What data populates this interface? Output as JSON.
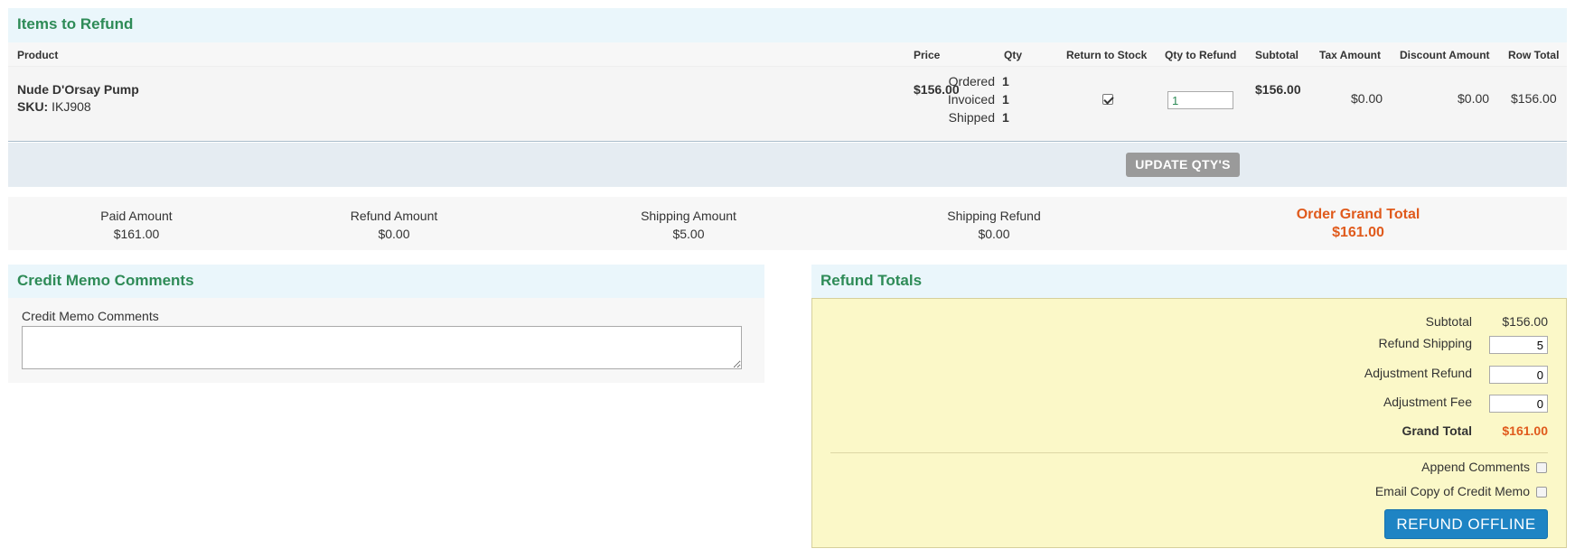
{
  "items_panel": {
    "title": "Items to Refund",
    "columns": {
      "product": "Product",
      "price": "Price",
      "qty": "Qty",
      "return_to_stock": "Return to Stock",
      "qty_to_refund": "Qty to Refund",
      "subtotal": "Subtotal",
      "tax_amount": "Tax Amount",
      "discount_amount": "Discount Amount",
      "row_total": "Row Total"
    },
    "row": {
      "product_name": "Nude D'Orsay Pump",
      "sku_label": "SKU:",
      "sku": "IKJ908",
      "price": "$156.00",
      "qty_ordered_label": "Ordered",
      "qty_ordered": "1",
      "qty_invoiced_label": "Invoiced",
      "qty_invoiced": "1",
      "qty_shipped_label": "Shipped",
      "qty_shipped": "1",
      "return_to_stock": true,
      "qty_to_refund": "1",
      "subtotal": "$156.00",
      "tax_amount": "$0.00",
      "discount_amount": "$0.00",
      "row_total": "$156.00"
    },
    "update_button": "UPDATE QTY'S"
  },
  "summary": {
    "paid_amount_label": "Paid Amount",
    "paid_amount": "$161.00",
    "refund_amount_label": "Refund Amount",
    "refund_amount": "$0.00",
    "shipping_amount_label": "Shipping Amount",
    "shipping_amount": "$5.00",
    "shipping_refund_label": "Shipping Refund",
    "shipping_refund": "$0.00",
    "grand_total_label": "Order Grand Total",
    "grand_total": "$161.00"
  },
  "comments_panel": {
    "title": "Credit Memo Comments",
    "field_label": "Credit Memo Comments",
    "field_value": ""
  },
  "refund_totals": {
    "title": "Refund Totals",
    "subtotal_label": "Subtotal",
    "subtotal": "$156.00",
    "refund_shipping_label": "Refund Shipping",
    "refund_shipping": "5",
    "adjustment_refund_label": "Adjustment Refund",
    "adjustment_refund": "0",
    "adjustment_fee_label": "Adjustment Fee",
    "adjustment_fee": "0",
    "grand_total_label": "Grand Total",
    "grand_total": "$161.00",
    "append_comments_label": "Append Comments",
    "append_comments_checked": false,
    "email_copy_label": "Email Copy of Credit Memo",
    "email_copy_checked": false,
    "refund_button": "REFUND OFFLINE"
  },
  "colors": {
    "section_title": "#2e8b57",
    "grand_total": "#e05a1c",
    "primary_button": "#1e84c4",
    "disabled_button": "#9a9a9a",
    "refund_totals_bg": "#fbf8c8"
  }
}
